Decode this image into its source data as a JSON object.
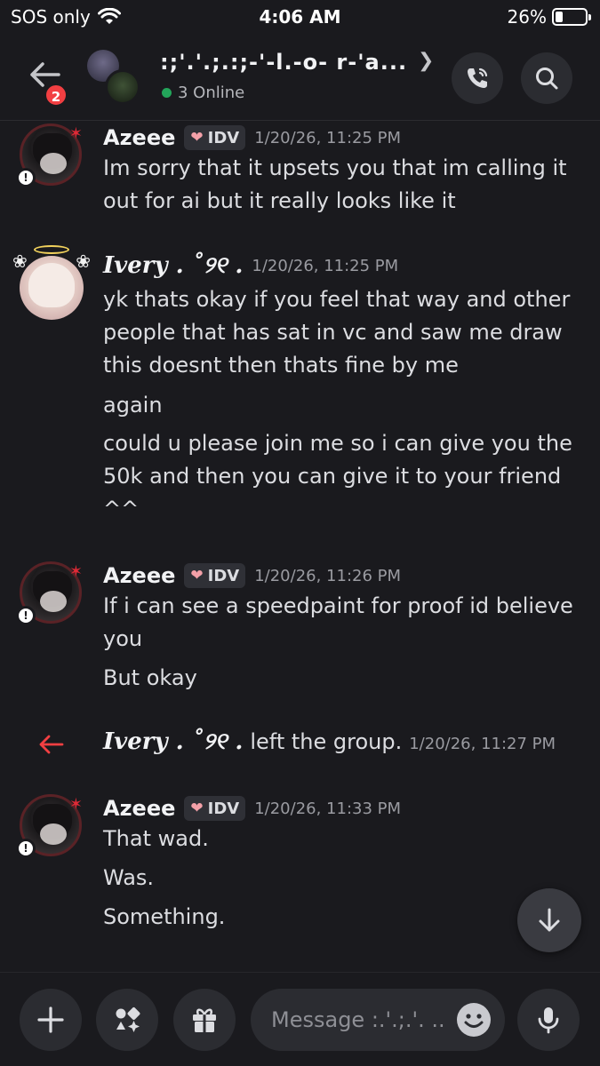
{
  "status_bar": {
    "carrier": "SOS only",
    "time": "4:06 AM",
    "battery": "26%",
    "battery_level": 0.26
  },
  "header": {
    "unread_count": "2",
    "group_name": ":;'.'.;.:;-'-l.-o- r-'a...",
    "online": "3 Online",
    "icons": [
      "back-arrow-icon",
      "call-icon",
      "search-icon",
      "chevron-right-icon"
    ]
  },
  "messages": [
    {
      "author": "Azeee",
      "tag": "IDV",
      "timestamp": "1/20/26, 11:25 PM",
      "lines": [
        "Im sorry that it upsets you that im calling it out for ai but it really looks like it"
      ]
    },
    {
      "author": "Ivery . ˚୨୧ .",
      "timestamp": "1/20/26, 11:25 PM",
      "lines": [
        "yk thats okay if you feel that way and other people that has sat in vc and saw me draw this doesnt then thats fine by me",
        "again",
        "could u please join me so i can give you the 50k and then you can give it to your friend ^^"
      ]
    },
    {
      "author": "Azeee",
      "tag": "IDV",
      "timestamp": "1/20/26, 11:26 PM",
      "lines": [
        "If i can see a speedpaint for proof id believe you",
        "But okay"
      ]
    },
    {
      "system": true,
      "author": "Ivery . ˚୨୧ .",
      "text": "left the group.",
      "timestamp": "1/20/26, 11:27 PM"
    },
    {
      "author": "Azeee",
      "tag": "IDV",
      "timestamp": "1/20/26, 11:33 PM",
      "lines": [
        "That wad.",
        "Was.",
        "Something."
      ]
    }
  ],
  "composer": {
    "placeholder": "Message :.'.;.'. ..",
    "icons": [
      "plus-icon",
      "apps-icon",
      "gift-icon",
      "emoji-icon",
      "microphone-icon"
    ]
  }
}
